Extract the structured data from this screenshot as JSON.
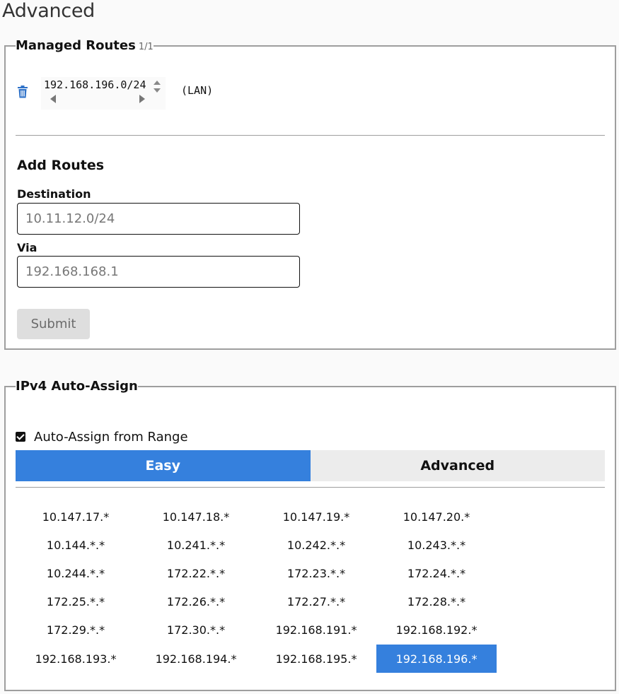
{
  "page": {
    "title": "Advanced"
  },
  "managed_routes": {
    "title": "Managed Routes",
    "count": "1/1",
    "routes": [
      {
        "destination": "192.168.196.0/24",
        "via": "(LAN)"
      }
    ]
  },
  "add_routes": {
    "title": "Add Routes",
    "destination_label": "Destination",
    "destination_placeholder": "10.11.12.0/24",
    "via_label": "Via",
    "via_placeholder": "192.168.168.1",
    "submit_label": "Submit"
  },
  "ipv4_auto_assign": {
    "title": "IPv4 Auto-Assign",
    "checkbox_label": "Auto-Assign from Range",
    "checked": true,
    "tabs": [
      {
        "label": "Easy",
        "active": true
      },
      {
        "label": "Advanced",
        "active": false
      }
    ],
    "ranges": [
      "10.147.17.*",
      "10.147.18.*",
      "10.147.19.*",
      "10.147.20.*",
      "10.144.*.*",
      "10.241.*.*",
      "10.242.*.*",
      "10.243.*.*",
      "10.244.*.*",
      "172.22.*.*",
      "172.23.*.*",
      "172.24.*.*",
      "172.25.*.*",
      "172.26.*.*",
      "172.27.*.*",
      "172.28.*.*",
      "172.29.*.*",
      "172.30.*.*",
      "192.168.191.*",
      "192.168.192.*",
      "192.168.193.*",
      "192.168.194.*",
      "192.168.195.*",
      "192.168.196.*"
    ],
    "selected_range": "192.168.196.*"
  },
  "colors": {
    "accent": "#3580dd",
    "trash_icon": "#2f72c8",
    "disabled_button_bg": "#dedede"
  },
  "icons": {
    "delete": "trash-icon",
    "spinner": "spin-arrows-icon",
    "scroll_left": "arrow-left-icon",
    "scroll_right": "arrow-right-icon"
  }
}
